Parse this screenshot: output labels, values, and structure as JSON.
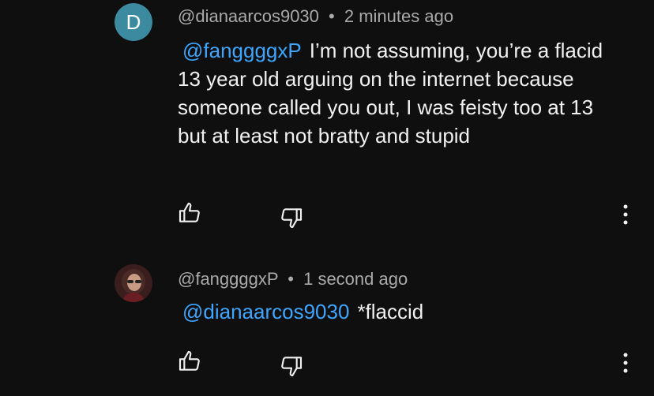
{
  "comments": [
    {
      "avatar_letter": "D",
      "avatar_color": "#3b8aa0",
      "author": "@dianaarcos9030",
      "separator": "•",
      "time": "2 minutes ago",
      "mention": "@fanggggxP",
      "text": "I’m not assuming, you’re a flacid 13 year old arguing on the internet because someone called you out, I was feisty too at 13 but at least not bratty and stupid",
      "like_icon": "thumbs-up-icon",
      "dislike_icon": "thumbs-down-icon",
      "more_icon": "more-vertical-icon"
    },
    {
      "avatar_icon": "profile-photo",
      "author": "@fanggggxP",
      "separator": "•",
      "time": "1 second ago",
      "mention": "@dianaarcos9030",
      "text": "*flaccid",
      "like_icon": "thumbs-up-icon",
      "dislike_icon": "thumbs-down-icon",
      "more_icon": "more-vertical-icon"
    }
  ],
  "colors": {
    "background": "#0f0f0f",
    "text": "#f1f1f1",
    "secondary_text": "#aaaaaa",
    "mention": "#3ea6ff"
  }
}
